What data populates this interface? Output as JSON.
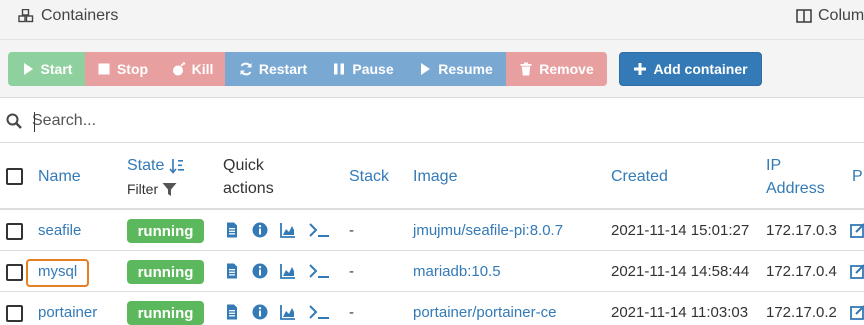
{
  "header": {
    "title": "Containers",
    "columns_label": "Colum"
  },
  "toolbar": {
    "start": "Start",
    "stop": "Stop",
    "kill": "Kill",
    "restart": "Restart",
    "pause": "Pause",
    "resume": "Resume",
    "remove": "Remove",
    "add_container": "Add container"
  },
  "search": {
    "placeholder": "Search..."
  },
  "table": {
    "headers": {
      "name": "Name",
      "state": "State",
      "state_filter": "Filter",
      "quick_actions_line1": "Quick",
      "quick_actions_line2": "actions",
      "stack": "Stack",
      "image": "Image",
      "created": "Created",
      "ip_line1": "IP",
      "ip_line2": "Address",
      "published_partial": "P"
    },
    "rows": [
      {
        "name": "seafile",
        "state": "running",
        "stack": "-",
        "image": "jmujmu/seafile-pi:8.0.7",
        "created": "2021-11-14 15:01:27",
        "ip": "172.17.0.3"
      },
      {
        "name": "mysql",
        "state": "running",
        "stack": "-",
        "image": "mariadb:10.5",
        "created": "2021-11-14 14:58:44",
        "ip": "172.17.0.4"
      },
      {
        "name": "portainer",
        "state": "running",
        "stack": "-",
        "image": "portainer/portainer-ce",
        "created": "2021-11-14 11:03:03",
        "ip": "172.17.0.2"
      }
    ]
  },
  "colors": {
    "running": "#5cb85c",
    "link": "#337ab7",
    "primary": "#337ab7",
    "success_light": "#8fd19e",
    "danger_light": "#e89f9f",
    "info_light": "#79a8d3",
    "selection_outline": "#e67e22"
  }
}
